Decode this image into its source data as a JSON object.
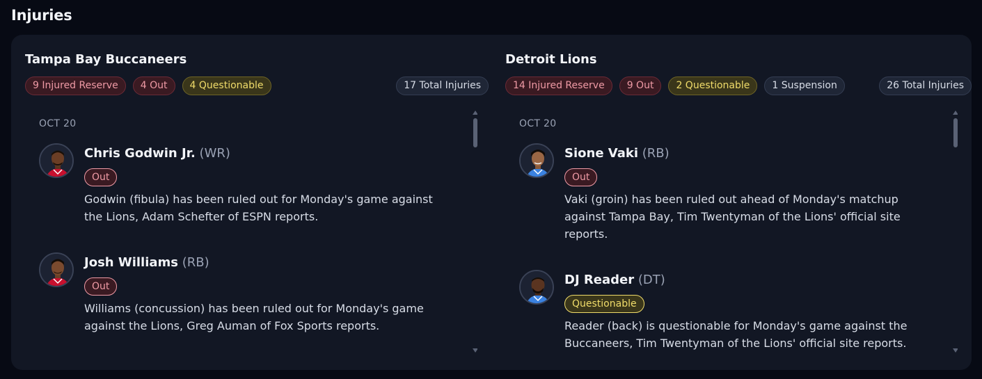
{
  "page": {
    "title": "Injuries"
  },
  "teams": [
    {
      "name": "Tampa Bay Buccaneers",
      "badges": [
        {
          "label": "9 Injured Reserve",
          "color": "#ef9aa5"
        },
        {
          "label": "4 Out",
          "color": "#ef9aa5"
        },
        {
          "label": "4 Questionable",
          "color": "#f0dc6a"
        }
      ],
      "total": "17 Total Injuries",
      "date": "OCT 20",
      "players": [
        {
          "name": "Chris Godwin Jr.",
          "position": "(WR)",
          "status": "Out",
          "note": "Godwin (fibula) has been ruled out for Monday's game against the Lions, Adam Schefter of ESPN reports.",
          "jersey_color": "#c8102e"
        },
        {
          "name": "Josh Williams",
          "position": "(RB)",
          "status": "Out",
          "note": "Williams (concussion) has been ruled out for Monday's game against the Lions, Greg Auman of Fox Sports reports.",
          "jersey_color": "#c8102e"
        }
      ]
    },
    {
      "name": "Detroit Lions",
      "badges": [
        {
          "label": "14 Injured Reserve",
          "color": "#ef9aa5"
        },
        {
          "label": "9 Out",
          "color": "#ef9aa5"
        },
        {
          "label": "2 Questionable",
          "color": "#f0dc6a"
        },
        {
          "label": "1 Suspension",
          "color": "#d8dde7"
        }
      ],
      "total": "26 Total Injuries",
      "date": "OCT 20",
      "players": [
        {
          "name": "Sione Vaki",
          "position": "(RB)",
          "status": "Out",
          "note": "Vaki (groin) has been ruled out ahead of Monday's matchup against Tampa Bay, Tim Twentyman of the Lions' official site reports.",
          "jersey_color": "#3b82e0"
        },
        {
          "name": "DJ Reader",
          "position": "(DT)",
          "status": "Questionable",
          "note": "Reader (back) is questionable for Monday's game against the Buccaneers, Tim Twentyman of the Lions' official site reports.",
          "jersey_color": "#3b82e0"
        }
      ]
    }
  ],
  "icons": {
    "scroll_up": "triangle-up-icon",
    "scroll_down": "triangle-down-icon"
  }
}
